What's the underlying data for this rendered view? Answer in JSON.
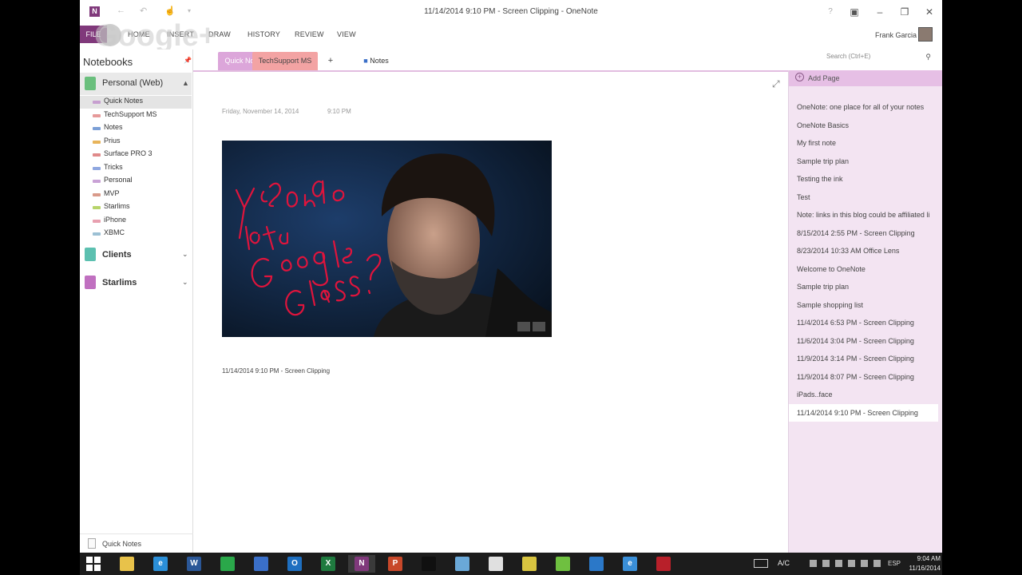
{
  "titlebar": {
    "app_logo": "N",
    "title": "11/14/2014 9:10 PM - Screen Clipping - OneNote",
    "buttons": [
      "help-icon",
      "ribbon-display-icon",
      "minimize-icon",
      "restore-icon",
      "close-icon"
    ]
  },
  "ribbon": {
    "file": "FILE",
    "tabs": [
      "HOME",
      "INSERT",
      "DRAW",
      "HISTORY",
      "REVIEW",
      "VIEW"
    ],
    "user": "Frank Garcia",
    "watermark": "Google+"
  },
  "notebooks": {
    "title": "Notebooks",
    "personal": {
      "name": "Personal (Web)",
      "color": "#6abf7d"
    },
    "sections": [
      {
        "label": "Quick Notes",
        "color": "#c79fd0"
      },
      {
        "label": "TechSupport MS",
        "color": "#e69a9a"
      },
      {
        "label": "Notes",
        "color": "#7b9fd6"
      },
      {
        "label": "Prius",
        "color": "#e8b45a"
      },
      {
        "label": "Surface PRO 3",
        "color": "#e08a8a"
      },
      {
        "label": "Tricks",
        "color": "#8fa7e0"
      },
      {
        "label": "Personal",
        "color": "#c9a2d6"
      },
      {
        "label": "MVP",
        "color": "#d99a8a"
      },
      {
        "label": "Starlims",
        "color": "#b7d46a"
      },
      {
        "label": "iPhone",
        "color": "#e8a0b0"
      },
      {
        "label": "XBMC",
        "color": "#9cc0d4"
      }
    ],
    "others": [
      {
        "name": "Clients",
        "color": "#5cc0b0"
      },
      {
        "name": "Starlims",
        "color": "#c070c0"
      }
    ],
    "footer": "Quick Notes"
  },
  "section_tabs": {
    "tabs": [
      {
        "label": "Quick Notes",
        "bg": "#dca6da"
      },
      {
        "label": "TechSupport MS",
        "bg": "#f3a3a3"
      }
    ],
    "add": "+",
    "notes": "Notes",
    "search_placeholder": "Search (Ctrl+E)"
  },
  "page": {
    "date": "Friday, November 14, 2014",
    "time": "9:10 PM",
    "handwriting": [
      "Y ¿Donde",
      "está",
      "Google",
      "Glass?"
    ],
    "caption": "11/14/2014 9:10 PM - Screen Clipping"
  },
  "pages": {
    "add_page": "Add Page",
    "items": [
      "OneNote: one place for all of your notes",
      "OneNote Basics",
      "My first note",
      "Sample trip plan",
      "Testing the ink",
      "Test",
      "Note: links in this blog could be affiliated li",
      "8/15/2014 2:55 PM - Screen Clipping",
      "8/23/2014 10:33 AM Office Lens",
      "Welcome to OneNote",
      "Sample trip plan",
      "Sample shopping list",
      "11/4/2014 6:53 PM - Screen Clipping",
      "11/6/2014 3:04 PM - Screen Clipping",
      "11/9/2014 3:14 PM - Screen Clipping",
      "11/9/2014 8:07 PM - Screen Clipping",
      "iPads..face",
      "11/14/2014 9:10 PM - Screen Clipping"
    ],
    "active_index": 17
  },
  "taskbar": {
    "apps": [
      {
        "name": "start-button",
        "color": "#1c1c1c",
        "glyph": ""
      },
      {
        "name": "file-explorer-app",
        "color": "#e8c24a",
        "glyph": ""
      },
      {
        "name": "internet-explorer-app",
        "color": "#2b8fd8",
        "glyph": "e"
      },
      {
        "name": "word-app",
        "color": "#2b5797",
        "glyph": "W"
      },
      {
        "name": "store-app",
        "color": "#2aa84a",
        "glyph": ""
      },
      {
        "name": "save-app",
        "color": "#3a6fc8",
        "glyph": ""
      },
      {
        "name": "outlook-app",
        "color": "#1e6fc0",
        "glyph": "O"
      },
      {
        "name": "excel-app",
        "color": "#1f7a3f",
        "glyph": "X"
      },
      {
        "name": "onenote-app",
        "color": "#80397b",
        "glyph": "N"
      },
      {
        "name": "powerpoint-app",
        "color": "#c8482a",
        "glyph": "P"
      },
      {
        "name": "terminal-app",
        "color": "#101010",
        "glyph": ""
      },
      {
        "name": "folder-app",
        "color": "#6aa8d8",
        "glyph": ""
      },
      {
        "name": "hangouts-app",
        "color": "#e0e0e0",
        "glyph": ""
      },
      {
        "name": "chrome-app",
        "color": "#d8c440",
        "glyph": ""
      },
      {
        "name": "android-app",
        "color": "#6fc040",
        "glyph": ""
      },
      {
        "name": "mail-app",
        "color": "#2b78c8",
        "glyph": ""
      },
      {
        "name": "ie-app",
        "color": "#3a8fd8",
        "glyph": "e"
      },
      {
        "name": "reader-app",
        "color": "#b8202a",
        "glyph": ""
      }
    ],
    "ac": "A/C",
    "lang": "ESP",
    "time": "9:04 AM",
    "date": "11/16/2014"
  }
}
